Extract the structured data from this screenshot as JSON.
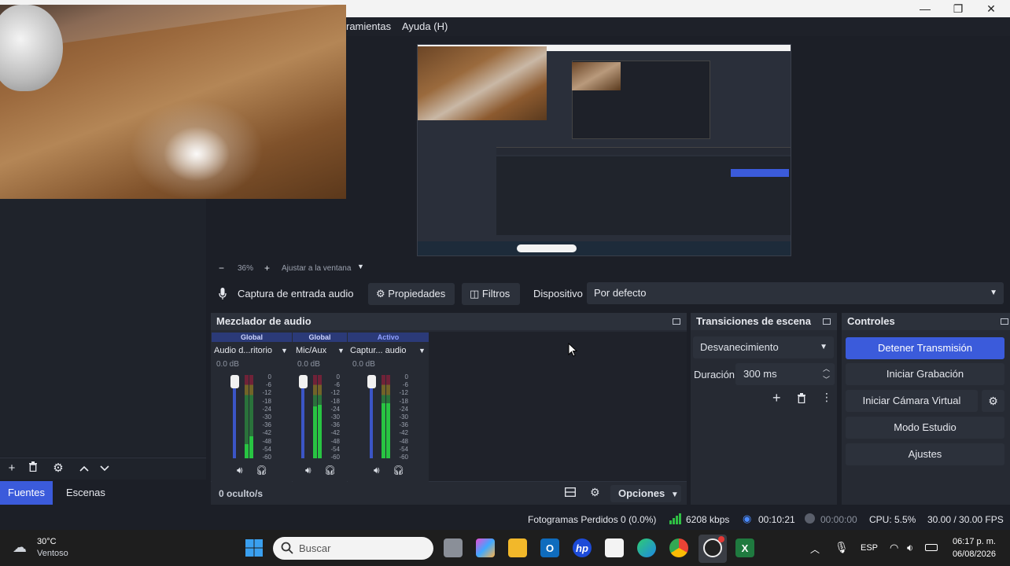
{
  "menu": {
    "tools": "ramientas",
    "help": "Ayuda (H)"
  },
  "window_controls": {
    "minimize": "—",
    "maximize": "❐",
    "close": "✕"
  },
  "zoom": {
    "minus": "−",
    "value": "36%",
    "plus": "+",
    "fit": "Ajustar a la ventana"
  },
  "source_toolbar": {
    "source_name": "Captura de entrada audio",
    "properties": "Propiedades",
    "filters": "Filtros",
    "device_label": "Dispositivo",
    "device_value": "Por defecto"
  },
  "docks": {
    "mixer_title": "Mezclador de audio",
    "transitions_title": "Transiciones de escena",
    "controls_title": "Controles"
  },
  "mixer": {
    "channels": [
      {
        "tag": "Global",
        "name": "Audio d...ritorio",
        "db": "0.0 dB"
      },
      {
        "tag": "Global",
        "name": "Mic/Aux",
        "db": "0.0 dB"
      },
      {
        "tag": "Activo",
        "name": "Captur... audio",
        "db": "0.0 dB"
      }
    ],
    "scale": [
      "0",
      "-6",
      "-12",
      "-18",
      "-24",
      "-30",
      "-36",
      "-42",
      "-48",
      "-54",
      "-60"
    ],
    "hidden": "0 oculto/s",
    "options": "Opciones"
  },
  "transitions": {
    "selected": "Desvanecimiento",
    "duration_label": "Duración",
    "duration_value": "300 ms"
  },
  "controls": {
    "stop_stream": "Detener Transmisión",
    "start_recording": "Iniciar Grabación",
    "start_virtual_cam": "Iniciar Cámara Virtual",
    "studio_mode": "Modo Estudio",
    "settings": "Ajustes"
  },
  "left_tabs": {
    "sources": "Fuentes",
    "scenes": "Escenas"
  },
  "status": {
    "dropped_frames": "Fotogramas Perdidos 0 (0.0%)",
    "bitrate": "6208 kbps",
    "stream_time": "00:10:21",
    "rec_time": "00:00:00",
    "cpu": "CPU: 5.5%",
    "fps": "30.00 / 30.00 FPS"
  },
  "taskbar": {
    "temp": "30°C",
    "weather": "Ventoso",
    "search_placeholder": "Buscar",
    "lang": "ESP",
    "time": "06:17 p. m.",
    "date": "06/08/2026"
  },
  "colors": {
    "accent": "#3b5bdb",
    "background": "#1c1f27",
    "dock": "#262a33"
  }
}
